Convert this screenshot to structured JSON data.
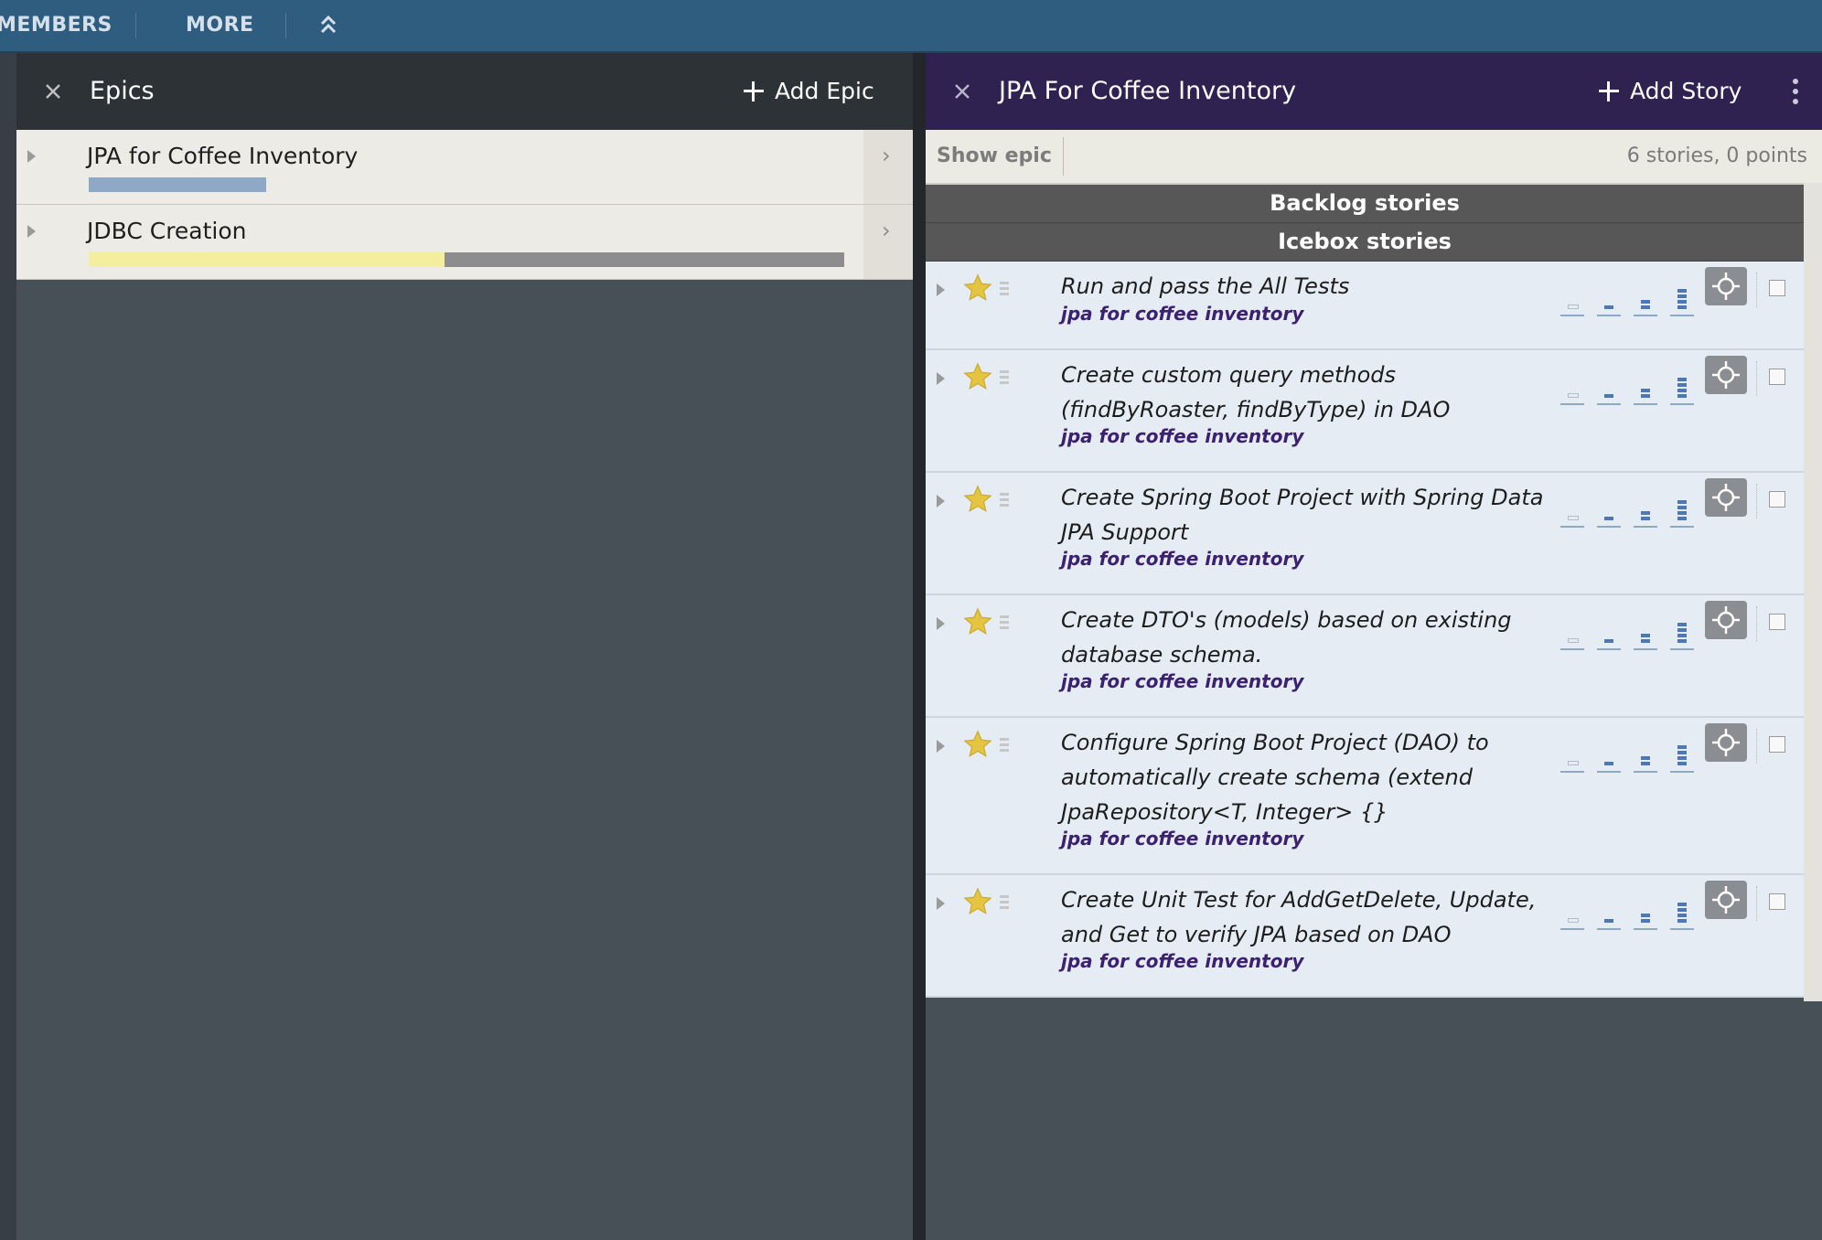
{
  "nav": {
    "members_label": "MEMBERS",
    "more_label": "MORE"
  },
  "epics_panel": {
    "title": "Epics",
    "add_label": "Add Epic",
    "epics": [
      {
        "name": "JPA for Coffee Inventory",
        "progress_accepted_fraction": 0.0,
        "progress_planned_fraction": 0.33,
        "bar_color": "#8fa8c6"
      },
      {
        "name": "JDBC Creation",
        "progress_done_fraction": 0.47,
        "done_color": "#f3ef9f",
        "remaining_color": "#8d8d8d"
      }
    ]
  },
  "stories_panel": {
    "title": "JPA For Coffee Inventory",
    "add_label": "Add Story",
    "show_epic_label": "Show epic",
    "count_text": "6 stories, 0 points",
    "sections": [
      "Backlog stories",
      "Icebox stories"
    ],
    "stories": [
      {
        "title": "Run and pass the All Tests",
        "label": "jpa for coffee inventory"
      },
      {
        "title": "Create custom query methods (findByRoaster, findByType) in DAO",
        "label": "jpa for coffee inventory"
      },
      {
        "title": "Create Spring Boot Project with Spring Data JPA Support",
        "label": "jpa for coffee inventory"
      },
      {
        "title": "Create DTO's (models) based on existing database schema.",
        "label": "jpa for coffee inventory"
      },
      {
        "title": "Configure Spring Boot Project (DAO) to automatically create schema (extend JpaRepository<T, Integer> {}",
        "label": "jpa for coffee inventory"
      },
      {
        "title": "Create Unit Test for AddGetDelete, Update, and Get to verify JPA based on DAO",
        "label": "jpa for coffee inventory"
      }
    ]
  },
  "colors": {
    "nav_bg": "#2f5d80",
    "stories_header_bg": "#2f2150",
    "story_bg": "#e5ecf3",
    "label_color": "#3b2170",
    "star_color": "#e4c441"
  },
  "icons": [
    "close-icon",
    "plus-icon",
    "chevron-right-icon",
    "kebab-menu-icon",
    "star-icon",
    "feature-type-icon",
    "estimate-icon",
    "move-icon",
    "collapse-up-icon"
  ]
}
